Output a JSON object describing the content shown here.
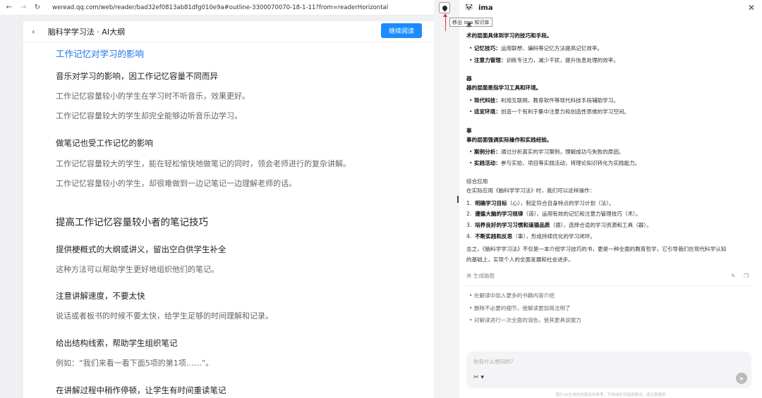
{
  "browser": {
    "back_icon": "←",
    "forward_icon": "→",
    "reload_icon": "↻",
    "url": "weread.qq.com/web/reader/bad32ef0813ab81dfg010e9a#outline-3300070070-18-1-11?from=readerHorizontal"
  },
  "reader": {
    "back_icon": "‹",
    "title": "脑科学学习法 · AI大纲",
    "continue_button": "继续阅读",
    "lines": [
      "工作记忆对学习的影响",
      "音乐对学习的影响，因工作记忆容量不同而异",
      "工作记忆容量较小的学生在学习时不听音乐，效果更好。",
      "工作记忆容量较大的学生却完全能够边听音乐边学习。",
      "做笔记也受工作记忆的影响",
      "工作记忆容量较大的学生，能在轻松愉快地做笔记的同时，领会老师进行的复杂讲解。",
      "工作记忆容量较小的学生，却很难做到一边记笔记一边理解老师的话。",
      "提高工作记忆容量较小者的笔记技巧",
      "提供梗概式的大纲或讲义，留出空白供学生补全",
      "这种方法可以帮助学生更好地组织他们的笔记。",
      "注意讲解速度，不要太快",
      "说话或者板书的时候不要太快，给学生足够的时间理解和记录。",
      "给出结构线索，帮助学生组织笔记",
      "例如：“我们来看一看下面5项的第1项……”。",
      "在讲解过程中稍作停顿，让学生有时间重读笔记"
    ]
  },
  "ima": {
    "panda_icon": "🐼",
    "name": "ima",
    "close_icon": "✕",
    "tooltip": "移出 ima 知识库",
    "content": {
      "l0": "术",
      "l1": "术的层面具体到学习的技巧和手段。",
      "l2b": "记忆技巧：",
      "l2": "运用联想、编码等记忆方法提高记忆效率。",
      "l3b": "注意力管理：",
      "l3": "训练专注力，减少干扰，提升信息处理的效率。",
      "l4": "器",
      "l5": "器的层面是指学习工具和环境。",
      "l6b": "现代科技：",
      "l6": "利用互联网、教育软件等现代科技手段辅助学习。",
      "l7b": "适宜环境：",
      "l7": "创造一个有利于集中注意力和创造性思维的学习空间。",
      "l8": "事",
      "l9": "事的层面强调实际操作和实践经验。",
      "l10b": "案例分析：",
      "l10": "通过分析真实的学习案例，理解成功与失败的原因。",
      "l11b": "实践活动：",
      "l11": "参与实验、项目等实践活动，将理论知识转化为实践能力。",
      "l12": "综合应用",
      "l13": "在实际应用《脑科学学习法》时，我们可以这样操作：",
      "n1b": "明确学习目标",
      "n1": "（心），制定符合自身特点的学习计划（法）。",
      "n2b": "遵循大脑的学习规律",
      "n2": "（道），运用有效的记忆和注意力管理技巧（术）。",
      "n3b": "培养良好的学习习惯和道德品质",
      "n3": "（德），选择合适的学习资源和工具（器）。",
      "n4b": "不断实践和反思",
      "n4": "（事），形成持续优化的学习闭环。",
      "s1": "总之，《脑科学学习法》不仅是一本介绍学习技巧的书，更是一种全面的教育哲学，它引导我们在现代科学认知",
      "s2": "的基础上，实现个人的全面发展和社会进步。"
    },
    "mindmap_label": "生成脑图",
    "suggestions": [
      "在解读中加入更多的书籍内容介绍",
      "删除不必要的细节，使解读更加简洁明了",
      "对解读进行一次全面的润色，使其更具说服力"
    ],
    "input_placeholder": "你有什么想问的?",
    "scissor_icon": "✂ ▾",
    "send_icon": "➤",
    "footer": "图片/AI生成的内容仅供参考，不构成任何投资建议，请注意甄别"
  }
}
